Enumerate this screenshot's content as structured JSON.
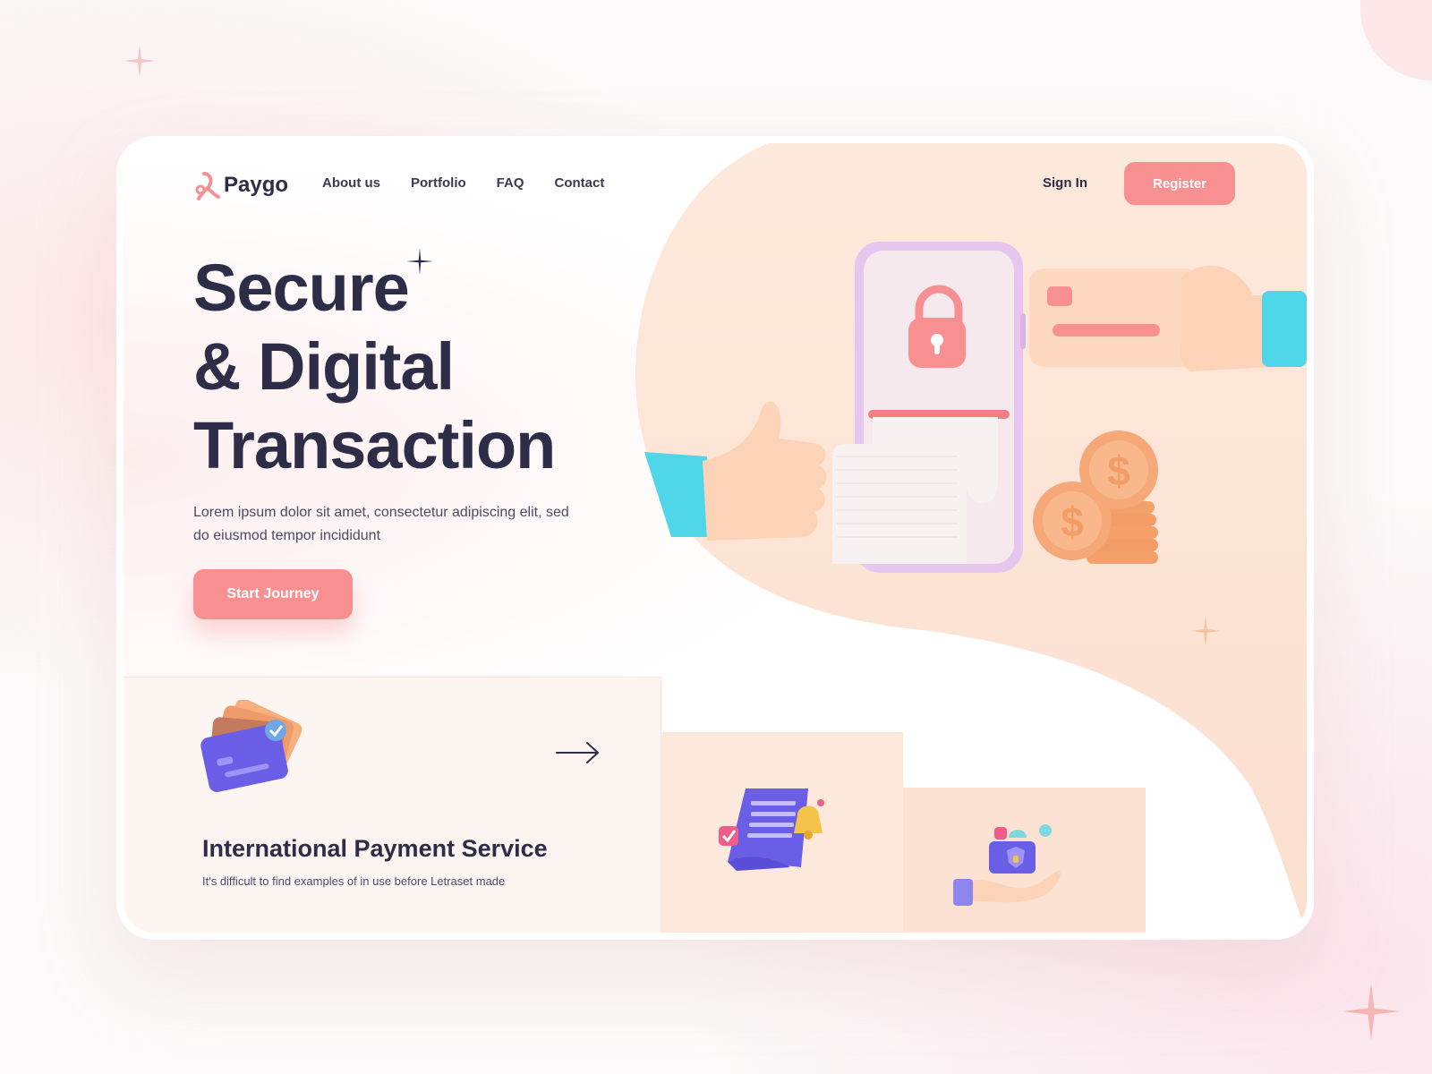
{
  "brand": {
    "name": "Paygo",
    "accent": "#f88f91",
    "dark": "#2e2d48",
    "peach": "#fde8dc"
  },
  "nav": {
    "links": [
      "About us",
      "Portfolio",
      "FAQ",
      "Contact"
    ],
    "sign_in": "Sign In",
    "register": "Register"
  },
  "hero": {
    "title_lines": [
      "Secure",
      "& Digital",
      "Transaction"
    ],
    "description": "Lorem ipsum dolor sit amet, consectetur adipiscing elit, sed do eiusmod tempor incididunt",
    "cta": "Start Journey"
  },
  "services": {
    "main": {
      "title": "International Payment Service",
      "description": "It's difficult to find examples of  in use before Letraset made"
    }
  },
  "icons": [
    "logo-icon",
    "sparkle-icon",
    "padlock-icon",
    "credit-card-icon",
    "thumbs-up-icon",
    "coins-icon",
    "receipt-icon",
    "arrow-right-icon",
    "cards-stack-icon",
    "invoice-bell-icon",
    "wallet-hand-icon"
  ]
}
